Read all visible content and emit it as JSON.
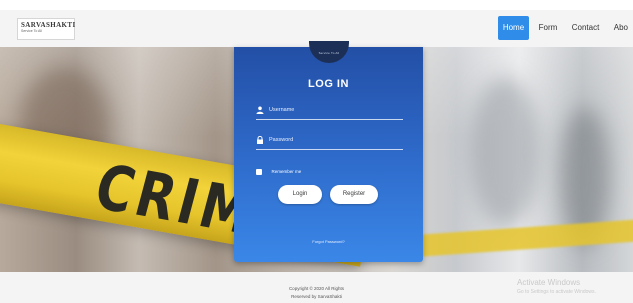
{
  "brand": {
    "name": "SARVASHAKTI",
    "tagline": "Service To All"
  },
  "nav": {
    "items": [
      {
        "label": "Home",
        "active": true
      },
      {
        "label": "Form",
        "active": false
      },
      {
        "label": "Contact",
        "active": false
      },
      {
        "label": "Abo",
        "active": false
      }
    ]
  },
  "hero": {
    "tape_text": "CRIME S"
  },
  "login": {
    "logo_text": "Service To All",
    "title": "LOG IN",
    "username_placeholder": "Username",
    "password_placeholder": "Password",
    "remember_label": "Remember me",
    "login_button": "Login",
    "register_button": "Register",
    "forgot_link": "Forgot Password?"
  },
  "footer": {
    "copyright_line1": "Copyright © 2020 All Rights",
    "copyright_line2": "Reserved by SarvaShakti"
  },
  "watermark": {
    "title": "Activate Windows",
    "subtitle": "Go to Settings to activate Windows."
  },
  "colors": {
    "accent": "#2f8ce8",
    "card_top": "#234fa6",
    "card_bottom": "#3a87e8",
    "tape": "#f2d33a"
  }
}
